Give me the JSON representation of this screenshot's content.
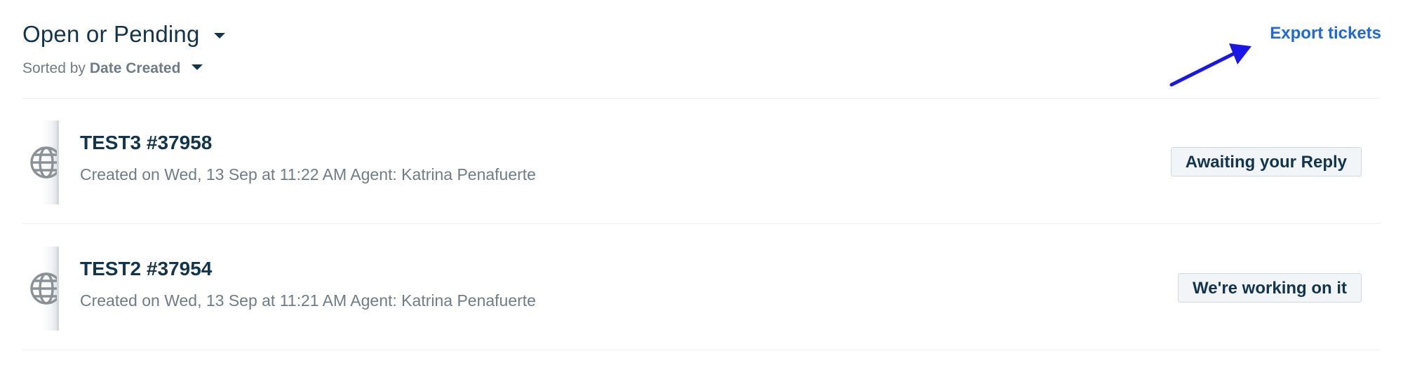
{
  "header": {
    "filter_label": "Open or Pending",
    "sort_prefix": "Sorted by",
    "sort_value": "Date Created",
    "export_label": "Export tickets"
  },
  "tickets": [
    {
      "subject": "TEST3 #37958",
      "meta": "Created on Wed, 13 Sep at 11:22 AM Agent: Katrina Penafuerte",
      "status": "Awaiting your Reply",
      "icon": "globe-icon"
    },
    {
      "subject": "TEST2 #37954",
      "meta": "Created on Wed, 13 Sep at 11:21 AM Agent: Katrina Penafuerte",
      "status": "We're working on it",
      "icon": "globe-icon"
    }
  ],
  "colors": {
    "text_primary": "#12344d",
    "text_muted": "#6f7c87",
    "link": "#1f6ad6",
    "annotation_arrow": "#1a16e8",
    "status_bg": "#f1f5f8"
  }
}
